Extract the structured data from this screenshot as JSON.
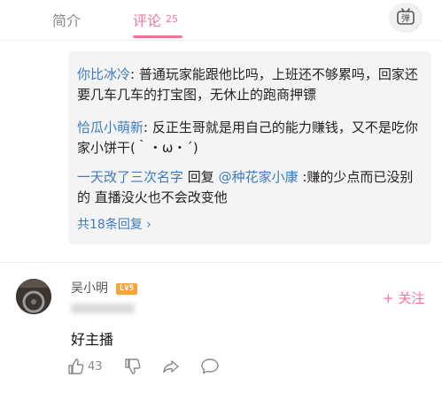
{
  "tabs": {
    "intro": "简介",
    "comment": "评论",
    "comment_count": "25",
    "danmaku_char": "弹"
  },
  "replies": [
    {
      "user": "你比冰冷",
      "sep": ": ",
      "text": "普通玩家能跟他比吗，上班还不够累吗，回家还要几车几车的打宝图，无休止的跑商押镖"
    },
    {
      "user": "恰瓜小萌新",
      "sep": ": ",
      "text": "反正生哥就是用自己的能力赚钱，又不是吃你家小饼干(｀・ω・´)"
    },
    {
      "user": "一天改了三次名字",
      "reply_word": " 回复 ",
      "target": "@种花家小康",
      "sep": " :",
      "text": "赚的少点而已没别的 直播没火也不会改变他"
    }
  ],
  "more_replies": "共18条回复 ›",
  "comment": {
    "username": "吴小明",
    "level": "LV5",
    "follow": "+ 关注",
    "text": "好主播",
    "likes": "43"
  },
  "icons": [
    "danmaku-icon",
    "thumbs-up-icon",
    "thumbs-down-icon",
    "share-icon",
    "reply-bubble-icon"
  ],
  "colors": {
    "accent": "#fb7299",
    "username_link": "#3d7bc0",
    "level_badge": "#f4a540"
  }
}
